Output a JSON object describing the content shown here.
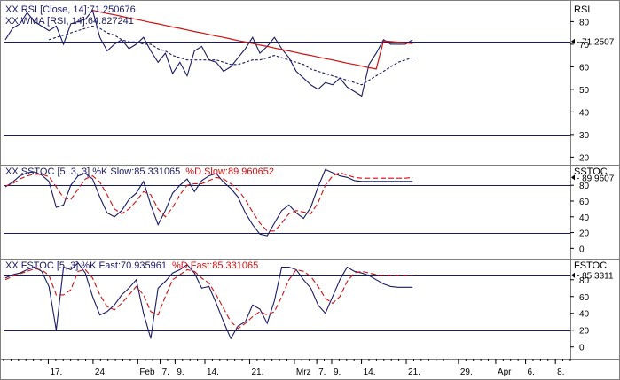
{
  "colors": {
    "series_primary": "#1a1a66",
    "series_secondary": "#d01010",
    "trendline": "#d01010",
    "reference_line": "#1a1a66",
    "grid": "#c8c8c8"
  },
  "chart_data": [
    {
      "type": "line",
      "panel": "rsi",
      "legend": [
        {
          "text": "XX RSI [Close, 14]:71.250676",
          "color": "#1a1a66"
        },
        {
          "text": "XX WMA [RSI, 14]:64.827241",
          "color": "#1a1a66"
        }
      ],
      "label": "RSI",
      "ylim": [
        17,
        88
      ],
      "yticks": [
        20,
        30,
        40,
        50,
        60,
        70,
        80
      ],
      "reference_lines": [
        71.25,
        30
      ],
      "last_value": {
        "text": "71.2507",
        "value": 71.25
      },
      "series": [
        {
          "style": "solid",
          "color": "#1a1a66",
          "values": [
            72,
            77,
            79,
            84,
            80,
            78,
            76,
            78,
            70,
            79,
            80,
            81,
            85,
            73,
            67,
            70,
            72,
            68,
            70,
            73,
            67,
            62,
            66,
            57,
            62,
            56,
            67,
            69,
            63,
            62,
            58,
            60,
            64,
            68,
            73,
            66,
            69,
            73,
            68,
            64,
            58,
            55,
            52,
            50,
            53,
            52,
            55,
            51,
            49,
            47,
            61,
            66,
            72,
            70,
            70,
            70,
            72
          ]
        },
        {
          "style": "dashed",
          "color": "#1a1a66",
          "values": [
            null,
            null,
            null,
            null,
            null,
            null,
            72,
            73,
            74,
            75,
            76,
            77,
            78,
            77,
            75,
            74,
            72,
            71,
            71,
            70,
            70,
            68,
            67,
            65,
            64,
            63,
            63,
            63,
            63,
            63,
            62,
            61,
            61,
            62,
            63,
            63,
            64,
            65,
            64,
            63,
            62,
            61,
            59,
            58,
            57,
            56,
            55,
            54,
            53,
            52,
            54,
            56,
            58,
            60,
            62,
            63,
            64
          ]
        },
        {
          "style": "solid",
          "color": "#d01010",
          "name": "trendline",
          "values": [
            null,
            null,
            null,
            null,
            null,
            null,
            null,
            null,
            null,
            null,
            null,
            null,
            85,
            84.3,
            83.6,
            83,
            82.3,
            81.6,
            81,
            80.3,
            79.6,
            79,
            78.3,
            77.6,
            77,
            76.3,
            75.6,
            75,
            74.3,
            73.6,
            73,
            72.3,
            71.6,
            71,
            70.3,
            69.6,
            69,
            68.3,
            67.6,
            67,
            66.3,
            65.6,
            65,
            64.3,
            63.6,
            63,
            62.3,
            61.6,
            61,
            60.3,
            59.6,
            59,
            71.5,
            71.2,
            70.9,
            70.6,
            70.3
          ]
        }
      ]
    },
    {
      "type": "line",
      "panel": "sstoc",
      "legend": [
        {
          "text": "XX SSTOC [5, 3, 3] %K Slow:85.331065",
          "color": "#1a1a66"
        },
        {
          "text": "%D Slow:89.960652",
          "color": "#d01010"
        }
      ],
      "label": "SSTOC",
      "ylim": [
        -12,
        105
      ],
      "yticks": [
        0,
        20,
        40,
        60,
        80
      ],
      "reference_lines": [
        80,
        20
      ],
      "last_value": {
        "text": "89.9607",
        "value": 89.96
      },
      "series": [
        {
          "style": "solid",
          "color": "#1a1a66",
          "values": [
            78,
            84,
            92,
            96,
            97,
            93,
            85,
            52,
            55,
            80,
            92,
            95,
            88,
            65,
            45,
            40,
            48,
            62,
            70,
            85,
            55,
            30,
            48,
            70,
            80,
            88,
            72,
            86,
            92,
            95,
            84,
            76,
            65,
            45,
            30,
            18,
            16,
            32,
            48,
            55,
            45,
            38,
            52,
            78,
            100,
            96,
            92,
            90,
            86,
            85,
            85,
            85,
            85,
            85,
            85,
            85,
            85
          ]
        },
        {
          "style": "dashed",
          "color": "#d01010",
          "values": [
            79,
            82,
            88,
            92,
            94,
            94,
            91,
            78,
            64,
            62,
            75,
            88,
            92,
            84,
            68,
            50,
            44,
            50,
            60,
            72,
            68,
            50,
            40,
            52,
            68,
            80,
            82,
            82,
            86,
            90,
            88,
            82,
            74,
            62,
            46,
            32,
            22,
            22,
            32,
            44,
            48,
            46,
            44,
            58,
            80,
            92,
            96,
            93,
            90,
            89,
            89,
            89,
            89,
            89,
            89,
            89,
            90
          ]
        }
      ]
    },
    {
      "type": "line",
      "panel": "fstoc",
      "legend": [
        {
          "text": "XX FSTOC [5, 3] %K Fast:70.935961",
          "color": "#1a1a66"
        },
        {
          "text": "%D Fast:85.331065",
          "color": "#d01010"
        }
      ],
      "label": "FSTOC",
      "ylim": [
        -14,
        104
      ],
      "yticks": [
        0,
        20,
        40,
        60,
        80
      ],
      "reference_lines": [
        85,
        20
      ],
      "last_value": {
        "text": "85.3311",
        "value": 85.33
      },
      "series": [
        {
          "style": "solid",
          "color": "#1a1a66",
          "values": [
            82,
            86,
            88,
            92,
            95,
            90,
            72,
            20,
            95,
            92,
            100,
            88,
            60,
            38,
            42,
            50,
            62,
            70,
            80,
            40,
            10,
            70,
            78,
            88,
            92,
            98,
            88,
            70,
            72,
            52,
            30,
            10,
            25,
            30,
            50,
            45,
            28,
            55,
            95,
            95,
            92,
            80,
            70,
            50,
            40,
            60,
            80,
            95,
            90,
            88,
            85,
            80,
            75,
            72,
            71,
            71,
            71
          ]
        },
        {
          "style": "dashed",
          "color": "#d01010",
          "values": [
            80,
            84,
            87,
            90,
            93,
            92,
            85,
            62,
            62,
            68,
            90,
            92,
            82,
            62,
            48,
            44,
            52,
            62,
            72,
            62,
            42,
            38,
            60,
            80,
            86,
            92,
            90,
            82,
            76,
            62,
            46,
            30,
            22,
            28,
            36,
            42,
            38,
            42,
            60,
            80,
            92,
            90,
            84,
            72,
            58,
            52,
            60,
            78,
            88,
            90,
            88,
            86,
            85,
            85,
            85,
            85,
            85
          ]
        }
      ]
    }
  ],
  "x_axis": {
    "labels": [
      "17.",
      "24.",
      "Feb",
      "7.",
      "9.",
      "14.",
      "21.",
      "Mrz",
      "7.",
      "9.",
      "14.",
      "21.",
      "29.",
      "Apr",
      "6.",
      "8."
    ],
    "positions": [
      6,
      12,
      18,
      21,
      23,
      27,
      33,
      39,
      42,
      44,
      48,
      54,
      61,
      66,
      70,
      74
    ]
  }
}
